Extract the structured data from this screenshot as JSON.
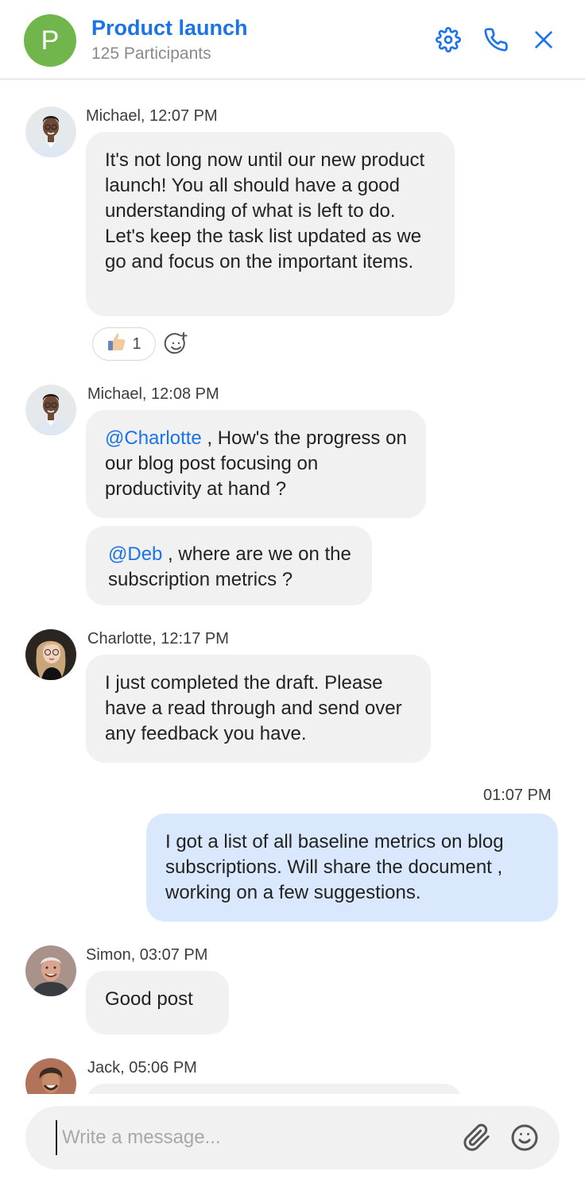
{
  "header": {
    "avatar_letter": "P",
    "title": "Product launch",
    "subtitle": "125 Participants",
    "icons": [
      "settings-icon",
      "phone-icon",
      "close-icon"
    ]
  },
  "messages": [
    {
      "sender": "Michael, 12:07 PM",
      "text": "It's not long now until our new product launch! You all should have a good understanding of what is left to do. Let's keep the task list updated as we go and focus on the important items.",
      "reaction": {
        "emoji": "thumbs-up",
        "count": "1"
      }
    },
    {
      "sender": "Michael, 12:08 PM",
      "bubble1": {
        "mention": "@Charlotte",
        "text": " , How's the progress on our  blog post focusing on productivity at hand ?"
      },
      "bubble2": {
        "mention": "@Deb",
        "text": " , where are we on the subscription metrics ?"
      }
    },
    {
      "sender": "Charlotte, 12:17 PM",
      "text": "I just completed the draft. Please have a read through and send over any feedback you have."
    },
    {
      "time": "01:07 PM",
      "text": "I got a list of all baseline metrics on blog subscriptions. Will share the document , working on a few suggestions."
    },
    {
      "sender": "Simon, 03:07 PM",
      "text": "Good post"
    },
    {
      "sender": "Jack, 05:06 PM"
    }
  ],
  "composer": {
    "placeholder": "Write a message...",
    "icons": [
      "attachment-icon",
      "emoji-icon"
    ]
  },
  "colors": {
    "accent": "#1a73e8",
    "group_avatar": "#70b64d",
    "bubble": "#f1f1f1",
    "my_bubble": "#d9e8fd"
  }
}
